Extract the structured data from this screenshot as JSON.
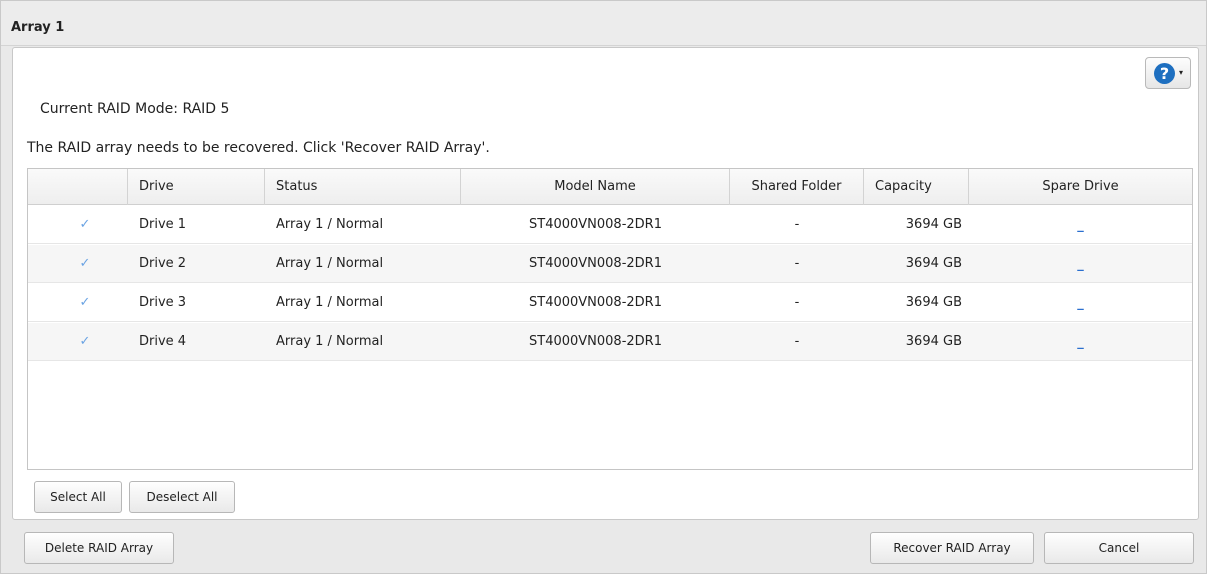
{
  "window": {
    "title": "Array 1"
  },
  "help": {
    "icon": "help-icon",
    "glyph": "?",
    "caret": "▾"
  },
  "raid": {
    "mode_label": "Current RAID Mode: RAID 5",
    "notice": "The RAID array needs to be recovered. Click 'Recover RAID Array'."
  },
  "table": {
    "columns": [
      "",
      "Drive",
      "Status",
      "Model Name",
      "Shared Folder",
      "Capacity",
      "Spare Drive"
    ],
    "rows": [
      {
        "checked": "✓",
        "drive": "Drive 1",
        "status": "Array 1 / Normal",
        "model": "ST4000VN008-2DR1",
        "shared": "-",
        "capacity": "3694 GB",
        "spare": "_"
      },
      {
        "checked": "✓",
        "drive": "Drive 2",
        "status": "Array 1 / Normal",
        "model": "ST4000VN008-2DR1",
        "shared": "-",
        "capacity": "3694 GB",
        "spare": "_"
      },
      {
        "checked": "✓",
        "drive": "Drive 3",
        "status": "Array 1 / Normal",
        "model": "ST4000VN008-2DR1",
        "shared": "-",
        "capacity": "3694 GB",
        "spare": "_"
      },
      {
        "checked": "✓",
        "drive": "Drive 4",
        "status": "Array 1 / Normal",
        "model": "ST4000VN008-2DR1",
        "shared": "-",
        "capacity": "3694 GB",
        "spare": "_"
      }
    ]
  },
  "buttons": {
    "select_all": "Select All",
    "deselect_all": "Deselect All",
    "delete": "Delete RAID Array",
    "recover": "Recover RAID Array",
    "cancel": "Cancel"
  },
  "colors": {
    "accent": "#1e6fc0",
    "checkmark": "#6aa3e3",
    "link": "#2a6fcf"
  }
}
